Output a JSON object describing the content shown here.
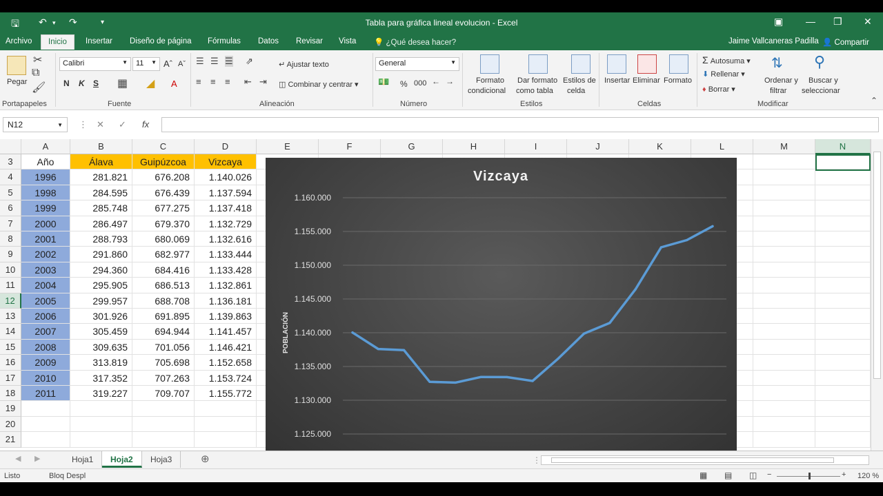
{
  "window": {
    "title": "Tabla para gráfica lineal evolucion - Excel",
    "user": "Jaime Vallcaneras Padilla",
    "share": "Compartir",
    "tell_me": "¿Qué desea hacer?"
  },
  "tabs": [
    "Archivo",
    "Inicio",
    "Insertar",
    "Diseño de página",
    "Fórmulas",
    "Datos",
    "Revisar",
    "Vista"
  ],
  "ribbon": {
    "clipboard": {
      "paste": "Pegar",
      "group": "Portapapeles"
    },
    "font": {
      "name": "Calibri",
      "size": "11",
      "bold": "N",
      "italic": "K",
      "underline": "S",
      "group": "Fuente"
    },
    "alignment": {
      "wrap": "Ajustar texto",
      "merge": "Combinar y centrar",
      "group": "Alineación"
    },
    "number": {
      "format": "General",
      "percent": "%",
      "thousands": "000",
      "group": "Número"
    },
    "styles": {
      "conditional_1": "Formato",
      "conditional_2": "condicional",
      "table_1": "Dar formato",
      "table_2": "como tabla",
      "cell_1": "Estilos de",
      "cell_2": "celda",
      "group": "Estilos"
    },
    "cells": {
      "insert": "Insertar",
      "delete": "Eliminar",
      "format": "Formato",
      "group": "Celdas"
    },
    "editing": {
      "autosum": "Autosuma",
      "fill": "Rellenar",
      "clear": "Borrar",
      "sort_1": "Ordenar y",
      "sort_2": "filtrar",
      "find_1": "Buscar y",
      "find_2": "seleccionar",
      "group": "Modificar"
    }
  },
  "formula_bar": {
    "name_box": "N12",
    "fx": "fx"
  },
  "columns": [
    "A",
    "B",
    "C",
    "D",
    "E",
    "F",
    "G",
    "H",
    "I",
    "J",
    "K",
    "L",
    "M",
    "N"
  ],
  "rows": [
    "3",
    "4",
    "5",
    "6",
    "7",
    "8",
    "9",
    "10",
    "11",
    "12",
    "13",
    "14",
    "15",
    "16",
    "17",
    "18",
    "19",
    "20",
    "21"
  ],
  "table": {
    "headers": [
      "Año",
      "Álava",
      "Guipúzcoa",
      "Vizcaya"
    ],
    "rows": [
      [
        "1996",
        "281.821",
        "676.208",
        "1.140.026"
      ],
      [
        "1998",
        "284.595",
        "676.439",
        "1.137.594"
      ],
      [
        "1999",
        "285.748",
        "677.275",
        "1.137.418"
      ],
      [
        "2000",
        "286.497",
        "679.370",
        "1.132.729"
      ],
      [
        "2001",
        "288.793",
        "680.069",
        "1.132.616"
      ],
      [
        "2002",
        "291.860",
        "682.977",
        "1.133.444"
      ],
      [
        "2003",
        "294.360",
        "684.416",
        "1.133.428"
      ],
      [
        "2004",
        "295.905",
        "686.513",
        "1.132.861"
      ],
      [
        "2005",
        "299.957",
        "688.708",
        "1.136.181"
      ],
      [
        "2006",
        "301.926",
        "691.895",
        "1.139.863"
      ],
      [
        "2007",
        "305.459",
        "694.944",
        "1.141.457"
      ],
      [
        "2008",
        "309.635",
        "701.056",
        "1.146.421"
      ],
      [
        "2009",
        "313.819",
        "705.698",
        "1.152.658"
      ],
      [
        "2010",
        "317.352",
        "707.263",
        "1.153.724"
      ],
      [
        "2011",
        "319.227",
        "709.707",
        "1.155.772"
      ]
    ]
  },
  "chart_data": {
    "type": "line",
    "title": "Vizcaya",
    "ylabel": "POBLACIÓN",
    "ylim": [
      1125000,
      1160000
    ],
    "yticks": [
      "1.160.000",
      "1.155.000",
      "1.150.000",
      "1.145.000",
      "1.140.000",
      "1.135.000",
      "1.130.000",
      "1.125.000"
    ],
    "ytick_values": [
      1160000,
      1155000,
      1150000,
      1145000,
      1140000,
      1135000,
      1130000,
      1125000
    ],
    "categories": [
      "1996",
      "1998",
      "1999",
      "2000",
      "2001",
      "2002",
      "2003",
      "2004",
      "2005",
      "2006",
      "2007",
      "2008",
      "2009",
      "2010",
      "2011"
    ],
    "values": [
      1140026,
      1137594,
      1137418,
      1132729,
      1132616,
      1133444,
      1133428,
      1132861,
      1136181,
      1139863,
      1141457,
      1146421,
      1152658,
      1153724,
      1155772
    ],
    "line_color": "#5b9bd5",
    "grid": true
  },
  "sheets": [
    "Hoja1",
    "Hoja2",
    "Hoja3"
  ],
  "status": {
    "ready": "Listo",
    "scroll_lock": "Bloq Despl",
    "zoom": "120 %"
  }
}
